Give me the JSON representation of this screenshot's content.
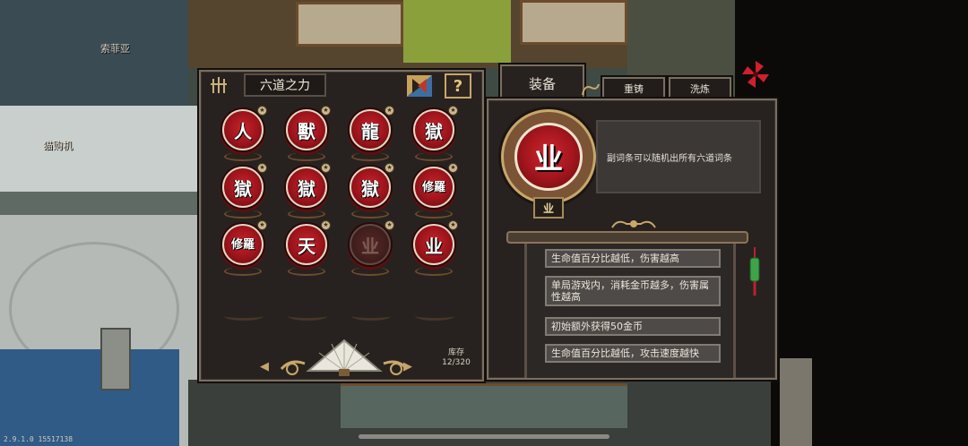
{
  "hud": {
    "version": "2.9.1.0 15517138",
    "npc_names": [
      "索菲亚",
      "猫购机"
    ]
  },
  "left_panel": {
    "title": "六道之力",
    "help_label": "?",
    "prev_label": "◀",
    "next_label": "▶",
    "stock_label": "库存",
    "stock_value": "12/320",
    "slots": [
      {
        "glyph": "人",
        "dim": false
      },
      {
        "glyph": "獸",
        "dim": false
      },
      {
        "glyph": "龍",
        "dim": false
      },
      {
        "glyph": "獄",
        "dim": false
      },
      {
        "glyph": "獄",
        "dim": false
      },
      {
        "glyph": "獄",
        "dim": false
      },
      {
        "glyph": "獄",
        "dim": false
      },
      {
        "glyph": "修羅",
        "dim": false
      },
      {
        "glyph": "修羅",
        "dim": false
      },
      {
        "glyph": "天",
        "dim": false
      },
      {
        "glyph": "业",
        "dim": true
      },
      {
        "glyph": "业",
        "dim": false
      }
    ],
    "empty_slot_count": 4
  },
  "tabs": {
    "equip": "装备",
    "reforge": "重铸",
    "wash": "洗炼"
  },
  "right_panel": {
    "big_glyph": "业",
    "description": "副词条可以随机出所有六道词条",
    "name_badge": "业",
    "affixes": [
      "生命值百分比越低，伤害越高",
      "单局游戏内，消耗金币越多，伤害属性越高",
      "初始额外获得50金币",
      "生命值百分比越低，攻击速度越快"
    ]
  },
  "colors": {
    "orb_red": "#b11a22",
    "panel_bg": "#27221f",
    "gold": "#c8a86a"
  }
}
